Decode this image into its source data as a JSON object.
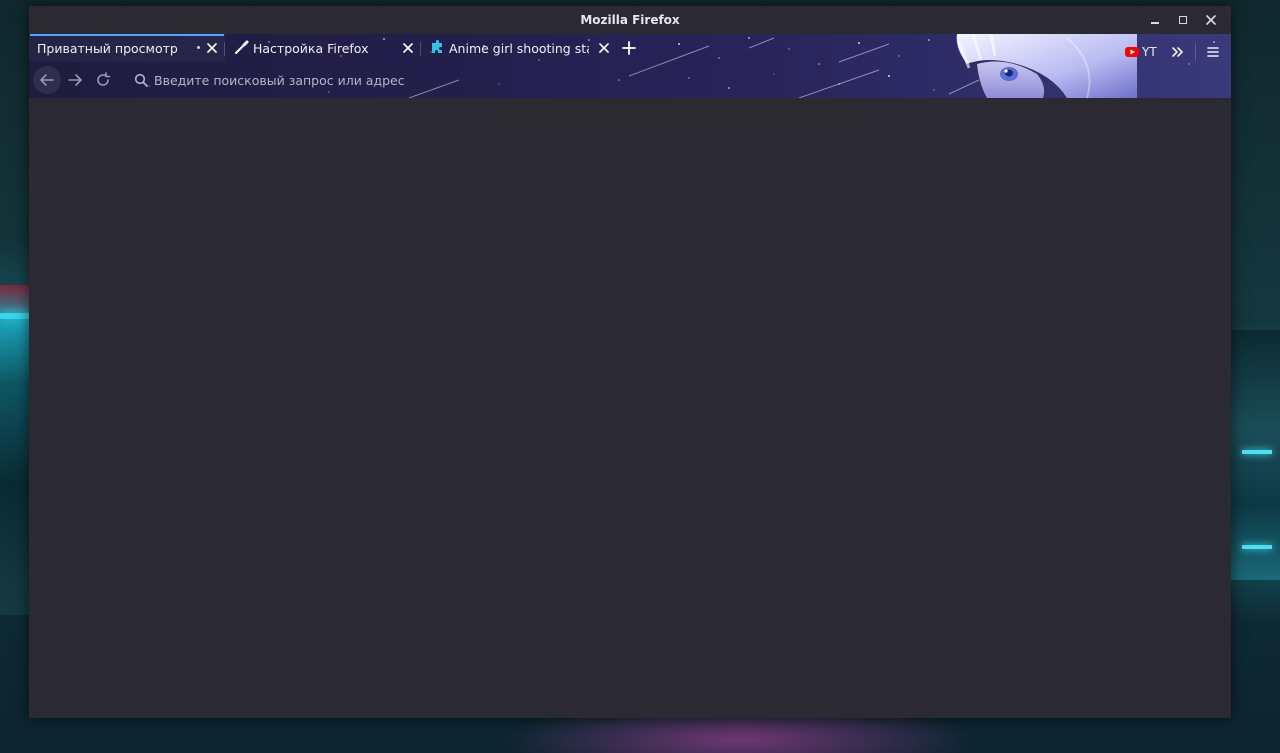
{
  "window": {
    "title": "Mozilla Firefox",
    "controls": {
      "minimize_icon": "minimize-icon",
      "maximize_icon": "maximize-icon",
      "close_icon": "close-icon"
    }
  },
  "tabs": [
    {
      "label": "Приватный просмотр",
      "active": true,
      "icon": "private-browsing-icon"
    },
    {
      "label": "Настройка Firefox",
      "active": false,
      "icon": "customize-brush-icon"
    },
    {
      "label": "Anime girl shooting stars",
      "active": false,
      "icon": "theme-puzzle-icon"
    }
  ],
  "newtab": {
    "icon": "plus-icon"
  },
  "navbar": {
    "back_icon": "back-arrow-icon",
    "forward_icon": "forward-arrow-icon",
    "reload_icon": "reload-icon",
    "url_placeholder": "Введите поисковый запрос или адрес",
    "url_value": ""
  },
  "bookmarks": {
    "items": [
      {
        "label": "YT",
        "icon": "youtube-icon"
      }
    ],
    "overflow_icon": "chevrons-right-icon"
  },
  "menu": {
    "icon": "hamburger-menu-icon"
  },
  "theme": {
    "accent": "#4aa6ff",
    "toolbar_bg": "#231f4c",
    "content_bg": "#2b2a33",
    "youtube_red": "#ff0000"
  }
}
